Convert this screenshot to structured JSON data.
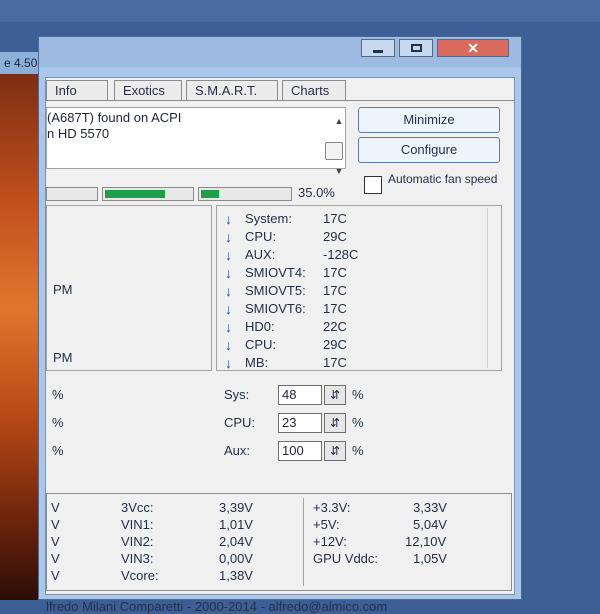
{
  "window": {
    "small_title": "e 4.50",
    "close_glyph": "✕"
  },
  "tabs": [
    "Info",
    "Exotics",
    "S.M.A.R.T.",
    "Charts"
  ],
  "info_lines": [
    "(A687T) found on ACPI",
    "n HD 5570"
  ],
  "buttons": {
    "minimize": "Minimize",
    "configure": "Configure"
  },
  "auto_fan": {
    "label": "Automatic fan speed",
    "checked": false
  },
  "progress": {
    "bars": [
      0.0,
      0.7,
      0.2
    ],
    "percent": "35.0%"
  },
  "fans": [
    "PM",
    "PM"
  ],
  "temperatures": [
    {
      "label": "System:",
      "value": "17C",
      "trend": "down-arrow"
    },
    {
      "label": "CPU:",
      "value": "29C",
      "trend": "down-arrow"
    },
    {
      "label": "AUX:",
      "value": "-128C",
      "trend": "down-arrow"
    },
    {
      "label": "SMIOVT4:",
      "value": "17C",
      "trend": "down-arrow"
    },
    {
      "label": "SMIOVT5:",
      "value": "17C",
      "trend": "down-arrow"
    },
    {
      "label": "SMIOVT6:",
      "value": "17C",
      "trend": "down-arrow"
    },
    {
      "label": "HD0:",
      "value": "22C",
      "trend": "down-arrow"
    },
    {
      "label": "CPU:",
      "value": "29C",
      "trend": "down-arrow"
    },
    {
      "label": "MB:",
      "value": "17C",
      "trend": "down-arrow"
    }
  ],
  "left_percent": [
    "%",
    "%",
    "%"
  ],
  "speeds": [
    {
      "label": "Sys:",
      "value": "48",
      "unit": "%"
    },
    {
      "label": "CPU:",
      "value": "23",
      "unit": "%"
    },
    {
      "label": "Aux:",
      "value": "100",
      "unit": "%"
    }
  ],
  "speed_button_glyph": "⇵",
  "voltages_left_units": [
    "V",
    "V",
    "V",
    "V",
    "V"
  ],
  "voltages_mid": [
    {
      "label": "3Vcc:",
      "value": "3,39V"
    },
    {
      "label": "VIN1:",
      "value": "1,01V"
    },
    {
      "label": "VIN2:",
      "value": "2,04V"
    },
    {
      "label": "VIN3:",
      "value": "0,00V"
    },
    {
      "label": "Vcore:",
      "value": "1,38V"
    }
  ],
  "voltages_right": [
    {
      "label": "+3.3V:",
      "value": "3,33V"
    },
    {
      "label": "+5V:",
      "value": "5,04V"
    },
    {
      "label": "+12V:",
      "value": "12,10V"
    },
    {
      "label": "GPU Vddc:",
      "value": "1,05V"
    }
  ],
  "footer": "lfredo Milani Comparetti - 2000-2014 - alfredo@almico.com",
  "colors": {
    "desktop": "#3d5f95",
    "progress_fill": "#1ea04a",
    "arrow": "#2447b8"
  }
}
